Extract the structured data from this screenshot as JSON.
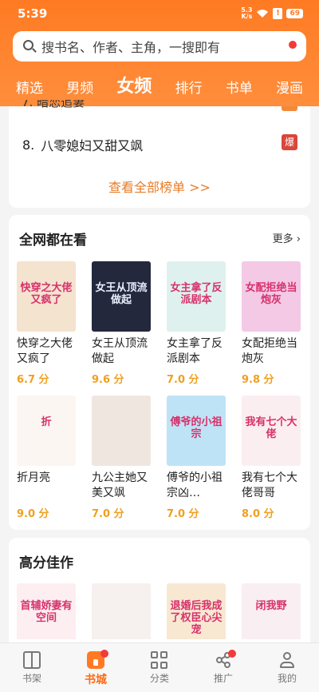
{
  "status_bar": {
    "time": "5:39",
    "net_speed_top": "5.3",
    "net_speed_bottom": "K/s",
    "battery": "69"
  },
  "search": {
    "placeholder": "搜书名、作者、主角，一搜即有"
  },
  "tabs": [
    "精选",
    "男频",
    "女频",
    "排行",
    "书单",
    "漫画"
  ],
  "active_tab": "女频",
  "ranking": {
    "item": {
      "rank": "8.",
      "title": "八零媳妇又甜又飒",
      "badge": "爆"
    },
    "see_all": "查看全部榜单 >>"
  },
  "section_all_web": {
    "title": "全网都在看",
    "more": "更多",
    "books": [
      {
        "title": "快穿之大佬又疯了",
        "score": "6.7 分",
        "cover_text": "快穿之大佬又疯了",
        "color": "#f4e3cf"
      },
      {
        "title": "女王从顶流做起",
        "score": "9.6 分",
        "cover_text": "女王从顶流做起",
        "color": "#23283d"
      },
      {
        "title": "女主拿了反派剧本",
        "score": "7.0 分",
        "cover_text": "女主拿了反派剧本",
        "color": "#dff1ee"
      },
      {
        "title": "女配拒绝当炮灰",
        "score": "9.8 分",
        "cover_text": "女配拒绝当炮灰",
        "color": "#f3c9e6"
      },
      {
        "title": "折月亮",
        "score": "9.0 分",
        "cover_text": "折",
        "color": "#fbf6f2"
      },
      {
        "title": "九公主她又美又飒",
        "score": "7.0 分",
        "cover_text": "",
        "color": "#f0e6e0"
      },
      {
        "title": "傅爷的小祖宗凶…",
        "score": "7.0 分",
        "cover_text": "傅爷的小祖宗",
        "color": "#bfe3f6"
      },
      {
        "title": "我有七个大佬哥哥",
        "score": "8.0 分",
        "cover_text": "我有七个大佬",
        "color": "#fbeef0"
      }
    ]
  },
  "section_high_score": {
    "title": "高分佳作",
    "books": [
      {
        "cover_text": "首辅娇妻有空间",
        "color": "#fdeef2"
      },
      {
        "cover_text": "",
        "color": "#f6f0ef"
      },
      {
        "cover_text": "退婚后我成了权臣心尖宠",
        "color": "#f8e8d2"
      },
      {
        "cover_text": "闭我野",
        "color": "#f9eef1"
      }
    ]
  },
  "bottom_nav": [
    {
      "label": "书架",
      "icon": "bookshelf-icon"
    },
    {
      "label": "书城",
      "icon": "bookstore-home-icon"
    },
    {
      "label": "分类",
      "icon": "category-grid-icon"
    },
    {
      "label": "推广",
      "icon": "share-icon"
    },
    {
      "label": "我的",
      "icon": "profile-icon"
    }
  ],
  "colors": {
    "accent": "#ff7a23",
    "score": "#f0a020",
    "see_all": "#e77d29",
    "hot": "#d9463b"
  }
}
